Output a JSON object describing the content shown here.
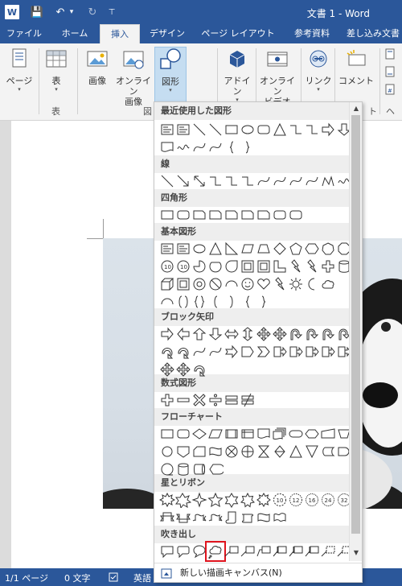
{
  "window": {
    "title": "文書 1 - Word",
    "app_icon_text": "W",
    "qa_save": "💾",
    "qa_undo": "↶",
    "qa_undo_arrow": "▾",
    "qa_redo": "↻",
    "qa_more": "⊤"
  },
  "tabs": [
    "ファイル",
    "ホーム",
    "挿入",
    "デザイン",
    "ページ レイアウト",
    "参考資料",
    "差し込み文書"
  ],
  "ribbon": {
    "buttons": {
      "pages": "ページ",
      "table": "表",
      "pictures": "画像",
      "online_pictures_1": "オンライン",
      "online_pictures_2": "画像",
      "shapes": "図形",
      "addins": "アドイン",
      "online_video_1": "オンライン",
      "online_video_2": "ビデオ",
      "links": "リンク",
      "comment": "コメント"
    },
    "groups": {
      "tables": "表",
      "illustrations": "図",
      "comments": "ト",
      "header": "ヘッダ"
    },
    "dropdown_arrow": "▾"
  },
  "shapes_menu": {
    "sections": [
      "最近使用した図形",
      "線",
      "四角形",
      "基本図形",
      "ブロック矢印",
      "数式図形",
      "フローチャート",
      "星とリボン",
      "吹き出し"
    ],
    "new_canvas": "新しい描画キャンバス(N)",
    "scroll_up": "▲",
    "scroll_down": "▼",
    "highlighted_shape": "cloud-callout"
  },
  "status": {
    "page": "1/1 ページ",
    "words": "0 文字",
    "language": "英語"
  },
  "colors": {
    "accent": "#2b579a",
    "highlight": "#e0141e",
    "ribbon_bg": "#f3f3f3"
  }
}
